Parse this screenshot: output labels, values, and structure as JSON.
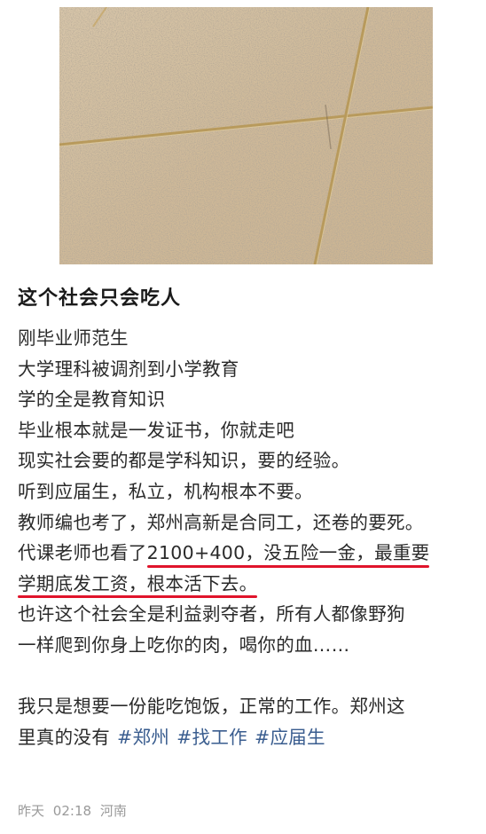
{
  "post": {
    "title": "这个社会只会吃人",
    "lines": [
      "刚毕业师范生",
      "大学理科被调剂到小学教育",
      "学的全是教育知识",
      "毕业根本就是一发证书，你就走吧",
      "现实社会要的都是学科知识，要的经验。",
      "听到应届生，私立，机构根本不要。",
      "教师编也考了，郑州高新是合同工，还卷的要死。"
    ],
    "line8_plain": "代课老师也看了",
    "line8_underlined": " 2100+400，没五险一金，最重要",
    "line9_underlined": "学期底发工资，根本活下去。",
    "line10": "也许这个社会全是利益剥夺者，所有人都像野狗",
    "line11": "一样爬到你身上吃你的肉，喝你的血……",
    "line12": "我只是想要一份能吃饱饭，正常的工作。郑州这",
    "line13_text": "里真的没有",
    "hashtags": [
      "#郑州",
      "#找工作",
      "#应届生"
    ],
    "meta": {
      "date": "昨天",
      "time": "02:18",
      "location": "河南"
    }
  },
  "colors": {
    "underline": "#e0142b",
    "hashtag": "#3a5d8f",
    "meta": "#9a9a9a"
  }
}
